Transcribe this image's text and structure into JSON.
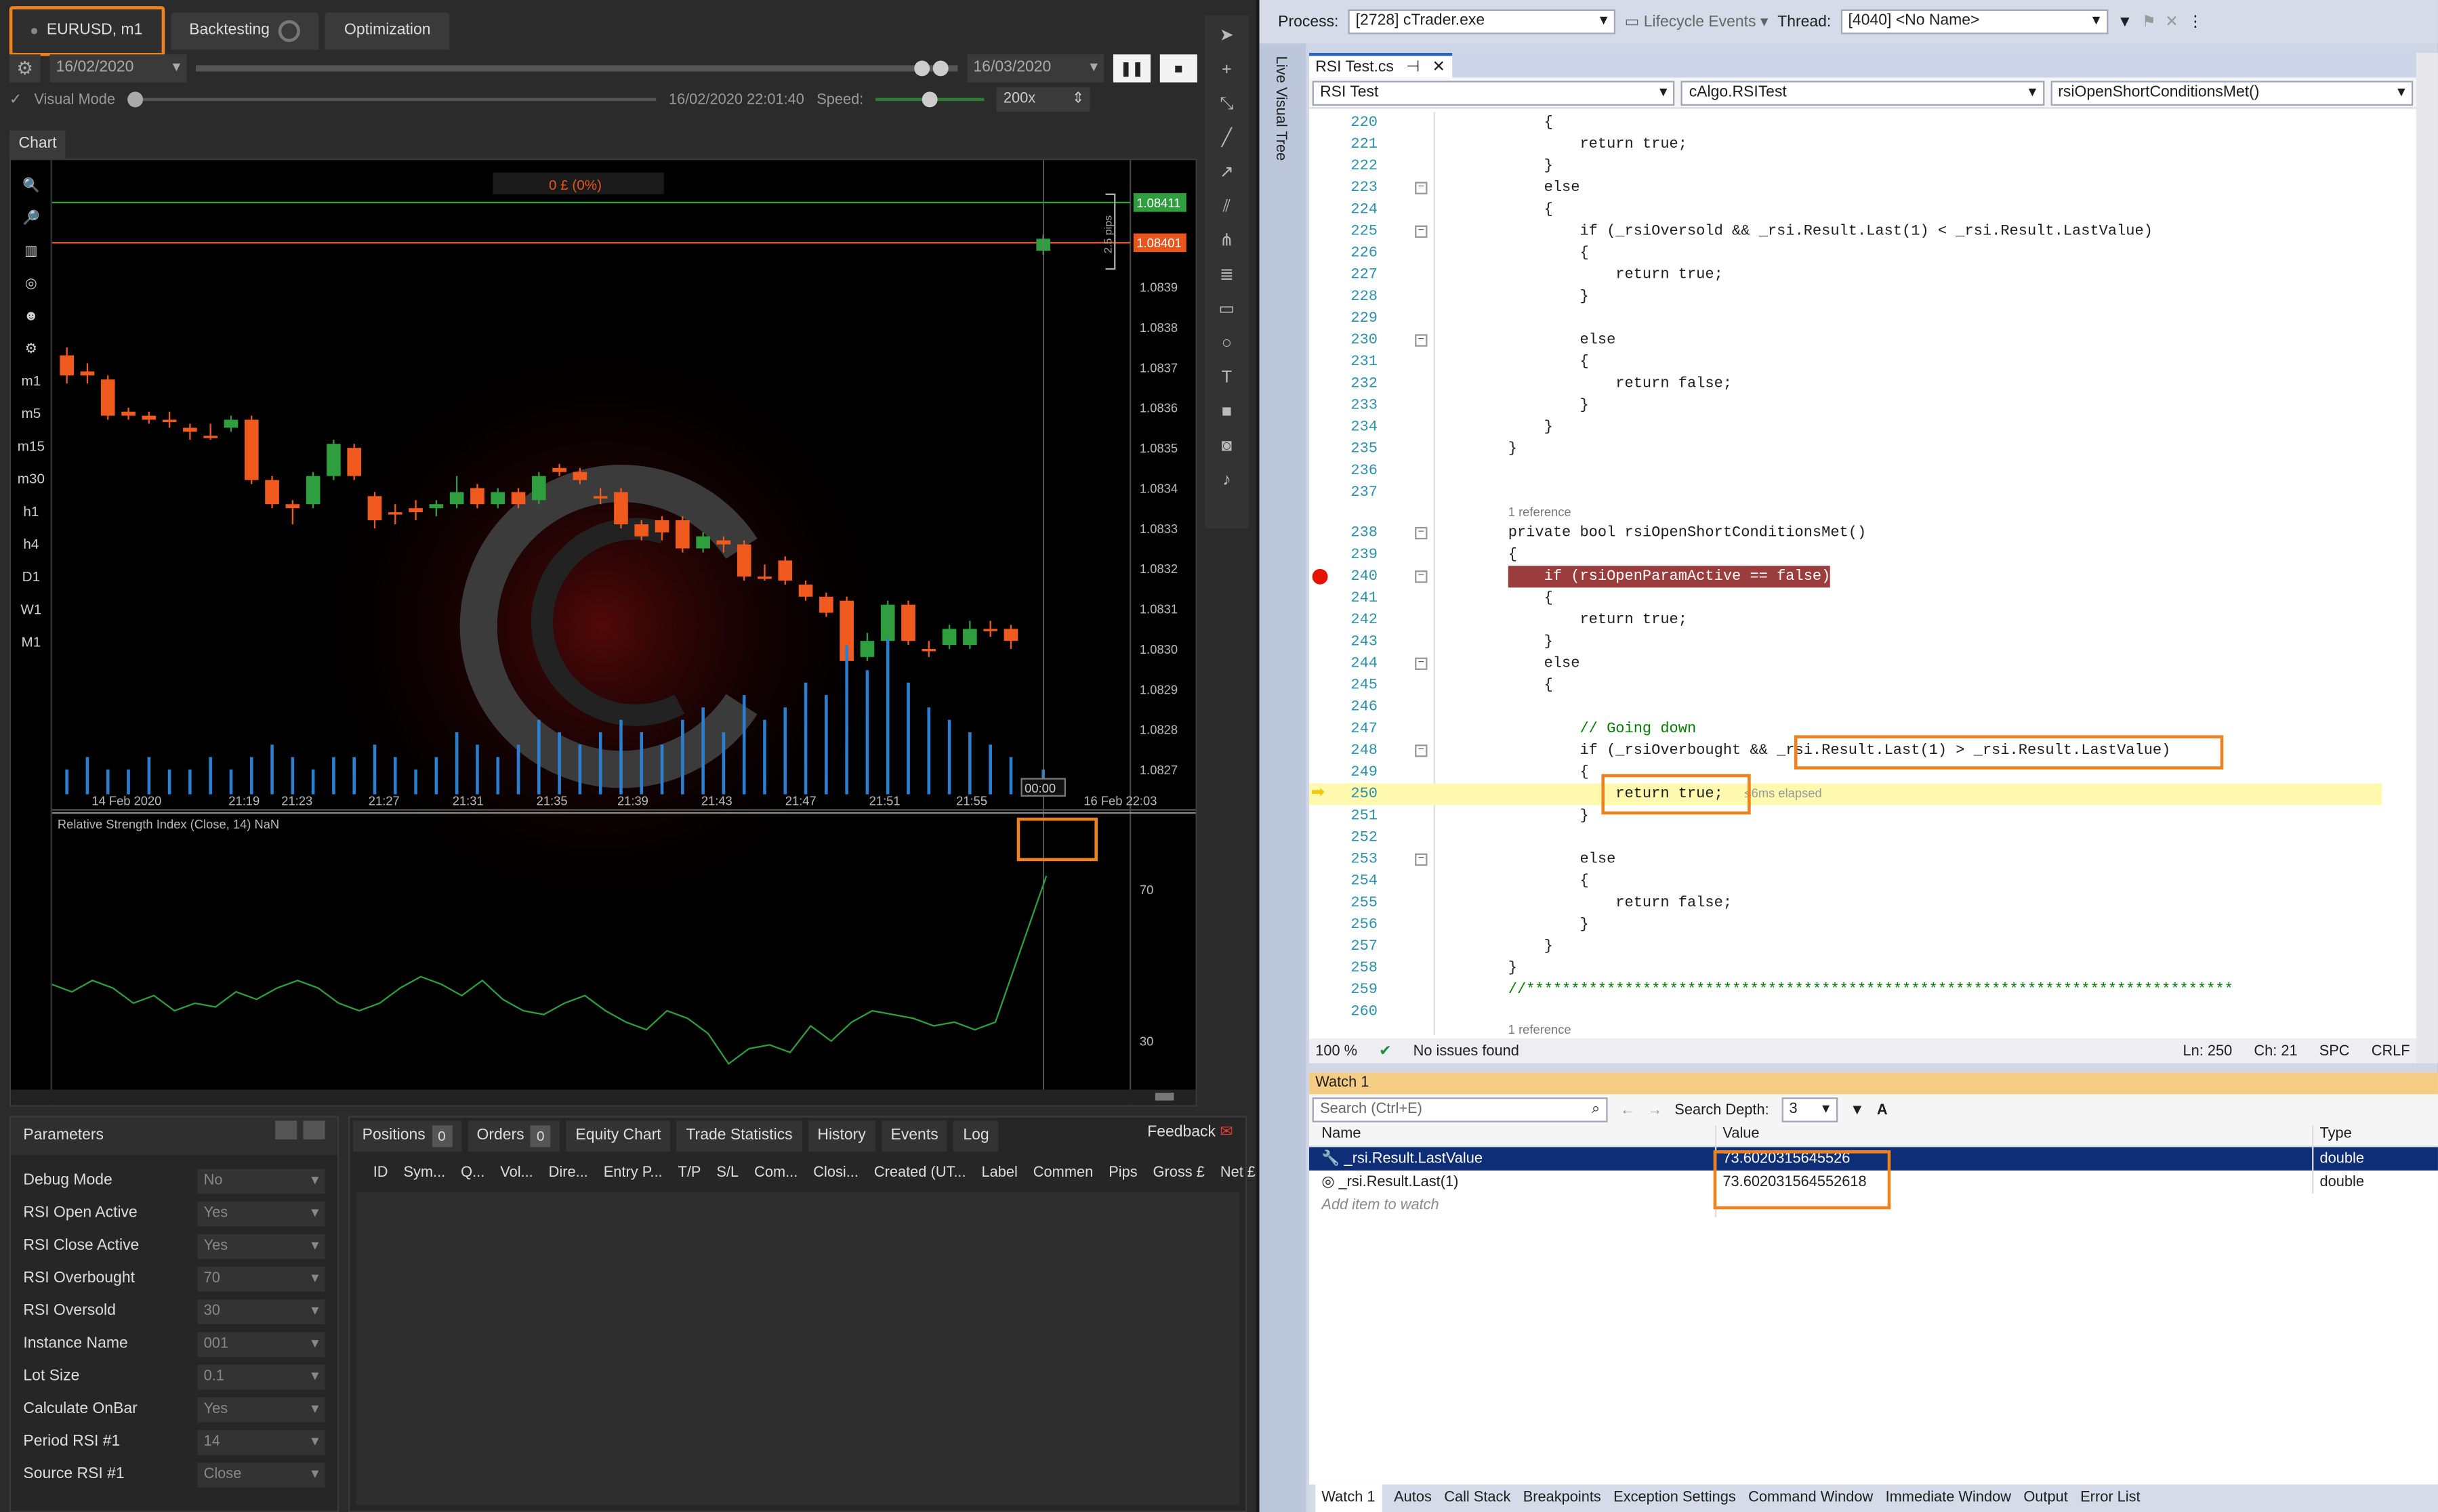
{
  "ctrader": {
    "tabs": {
      "symbol": "EURUSD, m1",
      "backtesting": "Backtesting",
      "optimization": "Optimization"
    },
    "start_date": "16/02/2020",
    "end_date": "16/03/2020",
    "visual_mode": "Visual Mode",
    "current_time": "16/02/2020 22:01:40",
    "speed_label": "Speed:",
    "speed_value": "200x",
    "chart_tab": "Chart",
    "pnl": "0 £ (0%)",
    "feedback": "Feedback",
    "params_title": "Parameters",
    "params": [
      {
        "label": "Debug Mode",
        "value": "No"
      },
      {
        "label": "RSI Open Active",
        "value": "Yes"
      },
      {
        "label": "RSI Close Active",
        "value": "Yes"
      },
      {
        "label": "RSI Overbought",
        "value": "70"
      },
      {
        "label": "RSI Oversold",
        "value": "30"
      },
      {
        "label": "Instance Name",
        "value": "001"
      },
      {
        "label": "Lot Size",
        "value": "0.1"
      },
      {
        "label": "Calculate OnBar",
        "value": "Yes"
      },
      {
        "label": "Period RSI #1",
        "value": "14"
      },
      {
        "label": "Source RSI #1",
        "value": "Close"
      }
    ],
    "bottom_tabs": [
      {
        "label": "Positions",
        "count": "0"
      },
      {
        "label": "Orders",
        "count": "0"
      },
      {
        "label": "Equity Chart"
      },
      {
        "label": "Trade Statistics"
      },
      {
        "label": "History"
      },
      {
        "label": "Events"
      },
      {
        "label": "Log"
      }
    ],
    "position_columns": [
      "ID",
      "Sym...",
      "Q...",
      "Vol...",
      "Dire...",
      "Entry P...",
      "T/P",
      "S/L",
      "Com...",
      "Closi...",
      "Created (UT...",
      "Label",
      "Commen",
      "Pips",
      "Gross £",
      "Net £"
    ],
    "left_tools": [
      "m1",
      "m5",
      "m15",
      "m30",
      "h1",
      "h4",
      "D1",
      "W1",
      "M1"
    ]
  },
  "chart_data": {
    "type": "candlestick",
    "price_axis": {
      "min": 1.0826,
      "max": 1.0842,
      "ticks": [
        "1.08411",
        "1.08401",
        "1.0839",
        "1.0838",
        "1.0837",
        "1.0836",
        "1.0835",
        "1.0834",
        "1.0833",
        "1.0832",
        "1.0831",
        "1.0830",
        "1.0829",
        "1.0828",
        "1.0827"
      ]
    },
    "time_ticks": [
      "14 Feb 2020",
      "21:19",
      "21:23",
      "21:27",
      "21:31",
      "21:35",
      "21:39",
      "21:43",
      "21:47",
      "21:51",
      "21:55",
      "16 Feb 22:03"
    ],
    "pips_label": "2.5 pips",
    "cursor_time": "00:00",
    "ask": "1.08411",
    "bid": "1.08401",
    "candles": [
      {
        "o": 1.08373,
        "c": 1.08368,
        "h": 1.08375,
        "l": 1.08366,
        "bull": false
      },
      {
        "o": 1.08369,
        "c": 1.08368,
        "h": 1.08371,
        "l": 1.08366,
        "bull": false
      },
      {
        "o": 1.08367,
        "c": 1.08358,
        "h": 1.08368,
        "l": 1.08357,
        "bull": false
      },
      {
        "o": 1.08359,
        "c": 1.08358,
        "h": 1.0836,
        "l": 1.08357,
        "bull": false
      },
      {
        "o": 1.08358,
        "c": 1.08357,
        "h": 1.08359,
        "l": 1.08356,
        "bull": false
      },
      {
        "o": 1.08357,
        "c": 1.08357,
        "h": 1.08359,
        "l": 1.08355,
        "bull": false
      },
      {
        "o": 1.08355,
        "c": 1.08354,
        "h": 1.08356,
        "l": 1.08352,
        "bull": false
      },
      {
        "o": 1.08353,
        "c": 1.08353,
        "h": 1.08356,
        "l": 1.08352,
        "bull": false
      },
      {
        "o": 1.08355,
        "c": 1.08357,
        "h": 1.08358,
        "l": 1.08354,
        "bull": true
      },
      {
        "o": 1.08357,
        "c": 1.08342,
        "h": 1.08358,
        "l": 1.08341,
        "bull": false
      },
      {
        "o": 1.08342,
        "c": 1.08336,
        "h": 1.08343,
        "l": 1.08335,
        "bull": false
      },
      {
        "o": 1.08336,
        "c": 1.08335,
        "h": 1.08337,
        "l": 1.08331,
        "bull": false
      },
      {
        "o": 1.08336,
        "c": 1.08343,
        "h": 1.08344,
        "l": 1.08335,
        "bull": true
      },
      {
        "o": 1.08343,
        "c": 1.08351,
        "h": 1.08352,
        "l": 1.08342,
        "bull": true
      },
      {
        "o": 1.0835,
        "c": 1.08343,
        "h": 1.08351,
        "l": 1.08342,
        "bull": false
      },
      {
        "o": 1.08338,
        "c": 1.08332,
        "h": 1.08339,
        "l": 1.0833,
        "bull": false
      },
      {
        "o": 1.08334,
        "c": 1.08334,
        "h": 1.08336,
        "l": 1.08331,
        "bull": false
      },
      {
        "o": 1.08335,
        "c": 1.08334,
        "h": 1.08337,
        "l": 1.08332,
        "bull": false
      },
      {
        "o": 1.08335,
        "c": 1.08336,
        "h": 1.08337,
        "l": 1.08333,
        "bull": true
      },
      {
        "o": 1.08336,
        "c": 1.08339,
        "h": 1.08343,
        "l": 1.08335,
        "bull": true
      },
      {
        "o": 1.0834,
        "c": 1.08336,
        "h": 1.08341,
        "l": 1.08335,
        "bull": false
      },
      {
        "o": 1.08336,
        "c": 1.08339,
        "h": 1.0834,
        "l": 1.08335,
        "bull": true
      },
      {
        "o": 1.08339,
        "c": 1.08336,
        "h": 1.0834,
        "l": 1.08335,
        "bull": false
      },
      {
        "o": 1.08337,
        "c": 1.08343,
        "h": 1.08344,
        "l": 1.08336,
        "bull": true
      },
      {
        "o": 1.08345,
        "c": 1.08344,
        "h": 1.08346,
        "l": 1.08343,
        "bull": false
      },
      {
        "o": 1.08344,
        "c": 1.08342,
        "h": 1.08345,
        "l": 1.08341,
        "bull": false
      },
      {
        "o": 1.08338,
        "c": 1.08338,
        "h": 1.0834,
        "l": 1.08336,
        "bull": false
      },
      {
        "o": 1.08339,
        "c": 1.08331,
        "h": 1.0834,
        "l": 1.0833,
        "bull": false
      },
      {
        "o": 1.08331,
        "c": 1.08328,
        "h": 1.08332,
        "l": 1.08327,
        "bull": false
      },
      {
        "o": 1.08332,
        "c": 1.08329,
        "h": 1.08333,
        "l": 1.08327,
        "bull": false
      },
      {
        "o": 1.08332,
        "c": 1.08325,
        "h": 1.08333,
        "l": 1.08324,
        "bull": false
      },
      {
        "o": 1.08325,
        "c": 1.08328,
        "h": 1.08329,
        "l": 1.08324,
        "bull": true
      },
      {
        "o": 1.08327,
        "c": 1.08326,
        "h": 1.08328,
        "l": 1.08324,
        "bull": false
      },
      {
        "o": 1.08326,
        "c": 1.08318,
        "h": 1.08327,
        "l": 1.08317,
        "bull": false
      },
      {
        "o": 1.08318,
        "c": 1.08318,
        "h": 1.08321,
        "l": 1.08317,
        "bull": false
      },
      {
        "o": 1.08322,
        "c": 1.08317,
        "h": 1.08323,
        "l": 1.08316,
        "bull": false
      },
      {
        "o": 1.08316,
        "c": 1.08313,
        "h": 1.08317,
        "l": 1.08312,
        "bull": false
      },
      {
        "o": 1.08313,
        "c": 1.08309,
        "h": 1.08314,
        "l": 1.08308,
        "bull": false
      },
      {
        "o": 1.08312,
        "c": 1.08297,
        "h": 1.08313,
        "l": 1.08296,
        "bull": false
      },
      {
        "o": 1.08298,
        "c": 1.08302,
        "h": 1.08304,
        "l": 1.08297,
        "bull": true
      },
      {
        "o": 1.08302,
        "c": 1.08311,
        "h": 1.08312,
        "l": 1.08301,
        "bull": true
      },
      {
        "o": 1.08311,
        "c": 1.08302,
        "h": 1.08312,
        "l": 1.08301,
        "bull": false
      },
      {
        "o": 1.083,
        "c": 1.083,
        "h": 1.08302,
        "l": 1.08298,
        "bull": false
      },
      {
        "o": 1.08301,
        "c": 1.08305,
        "h": 1.08306,
        "l": 1.083,
        "bull": true
      },
      {
        "o": 1.08301,
        "c": 1.08305,
        "h": 1.08307,
        "l": 1.083,
        "bull": true
      },
      {
        "o": 1.08305,
        "c": 1.08305,
        "h": 1.08307,
        "l": 1.08303,
        "bull": false
      },
      {
        "o": 1.08305,
        "c": 1.08302,
        "h": 1.08306,
        "l": 1.083,
        "bull": false
      },
      {
        "o": 1.08399,
        "c": 1.08402,
        "h": 1.08403,
        "l": 1.08398,
        "bull": true
      }
    ],
    "volumes": [
      2,
      3,
      2,
      2,
      3,
      2,
      2,
      3,
      2,
      3,
      4,
      3,
      2,
      3,
      3,
      4,
      3,
      2,
      3,
      5,
      4,
      3,
      4,
      6,
      5,
      4,
      5,
      6,
      5,
      4,
      6,
      7,
      5,
      8,
      6,
      7,
      9,
      8,
      12,
      10,
      14,
      9,
      7,
      6,
      5,
      4,
      3,
      2
    ],
    "rsi": {
      "label": "Relative Strength Index (Close, 14) NaN",
      "levels": [
        "70",
        "30"
      ],
      "values": [
        45,
        43,
        46,
        44,
        40,
        42,
        38,
        40,
        39,
        43,
        41,
        44,
        46,
        44,
        40,
        38,
        40,
        44,
        47,
        45,
        42,
        46,
        41,
        38,
        37,
        40,
        42,
        38,
        35,
        33,
        38,
        36,
        32,
        24,
        28,
        29,
        27,
        34,
        30,
        35,
        38,
        37,
        36,
        34,
        35,
        33,
        35,
        73.6
      ]
    }
  },
  "vs": {
    "process_label": "Process:",
    "process_value": "[2728] cTrader.exe",
    "lifecycle": "Lifecycle Events",
    "thread_label": "Thread:",
    "thread_value": "[4040] <No Name>",
    "live_visual_tree": "Live Visual Tree",
    "doc_tab": "RSI Test.cs",
    "nav": {
      "project": "RSI Test",
      "class": "cAlgo.RSITest",
      "member": "rsiOpenShortConditionsMet()"
    },
    "ref_label": "1 reference",
    "elapsed": "≤6ms elapsed",
    "status": {
      "zoom": "100 %",
      "issues": "No issues found",
      "ln": "Ln: 250",
      "ch": "Ch: 21",
      "spc": "SPC",
      "crlf": "CRLF"
    },
    "code": [
      {
        "n": "220",
        "t": "    {"
      },
      {
        "n": "221",
        "t": "        return true;"
      },
      {
        "n": "222",
        "t": "    }"
      },
      {
        "n": "223",
        "t": "    else"
      },
      {
        "n": "224",
        "t": "    {"
      },
      {
        "n": "225",
        "t": "        if (_rsiOversold && _rsi.Result.Last(1) < _rsi.Result.LastValue)"
      },
      {
        "n": "226",
        "t": "        {"
      },
      {
        "n": "227",
        "t": "            return true;"
      },
      {
        "n": "228",
        "t": "        }"
      },
      {
        "n": "229",
        "t": ""
      },
      {
        "n": "230",
        "t": "        else"
      },
      {
        "n": "231",
        "t": "        {"
      },
      {
        "n": "232",
        "t": "            return false;"
      },
      {
        "n": "233",
        "t": "        }"
      },
      {
        "n": "234",
        "t": "    }"
      },
      {
        "n": "235",
        "t": "}"
      },
      {
        "n": "236",
        "t": ""
      },
      {
        "n": "237",
        "t": ""
      },
      {
        "n": "238",
        "t": "private bool rsiOpenShortConditionsMet()"
      },
      {
        "n": "239",
        "t": "{"
      },
      {
        "n": "240",
        "t": "    if (rsiOpenParamActive == false)"
      },
      {
        "n": "241",
        "t": "    {"
      },
      {
        "n": "242",
        "t": "        return true;"
      },
      {
        "n": "243",
        "t": "    }"
      },
      {
        "n": "244",
        "t": "    else"
      },
      {
        "n": "245",
        "t": "    {"
      },
      {
        "n": "246",
        "t": ""
      },
      {
        "n": "247",
        "t": "        // Going down"
      },
      {
        "n": "248",
        "t": "        if (_rsiOverbought && _rsi.Result.Last(1) > _rsi.Result.LastValue)"
      },
      {
        "n": "249",
        "t": "        {"
      },
      {
        "n": "250",
        "t": "            return true;"
      },
      {
        "n": "251",
        "t": "        }"
      },
      {
        "n": "252",
        "t": ""
      },
      {
        "n": "253",
        "t": "        else"
      },
      {
        "n": "254",
        "t": "        {"
      },
      {
        "n": "255",
        "t": "            return false;"
      },
      {
        "n": "256",
        "t": "        }"
      },
      {
        "n": "257",
        "t": "    }"
      },
      {
        "n": "258",
        "t": "}"
      },
      {
        "n": "259",
        "t": "//*******************************************************************************"
      },
      {
        "n": "260",
        "t": ""
      }
    ],
    "watch": {
      "title": "Watch 1",
      "search_placeholder": "Search (Ctrl+E)",
      "depth_label": "Search Depth:",
      "depth_value": "3",
      "col_name": "Name",
      "col_value": "Value",
      "col_type": "Type",
      "rows": [
        {
          "name": "_rsi.Result.LastValue",
          "value": "73.6020315645526",
          "type": "double"
        },
        {
          "name": "_rsi.Result.Last(1)",
          "value": "73.602031564552618",
          "type": "double"
        }
      ],
      "add_item": "Add item to watch",
      "tabs": [
        "Watch 1",
        "Autos",
        "Call Stack",
        "Breakpoints",
        "Exception Settings",
        "Command Window",
        "Immediate Window",
        "Output",
        "Error List"
      ]
    }
  }
}
